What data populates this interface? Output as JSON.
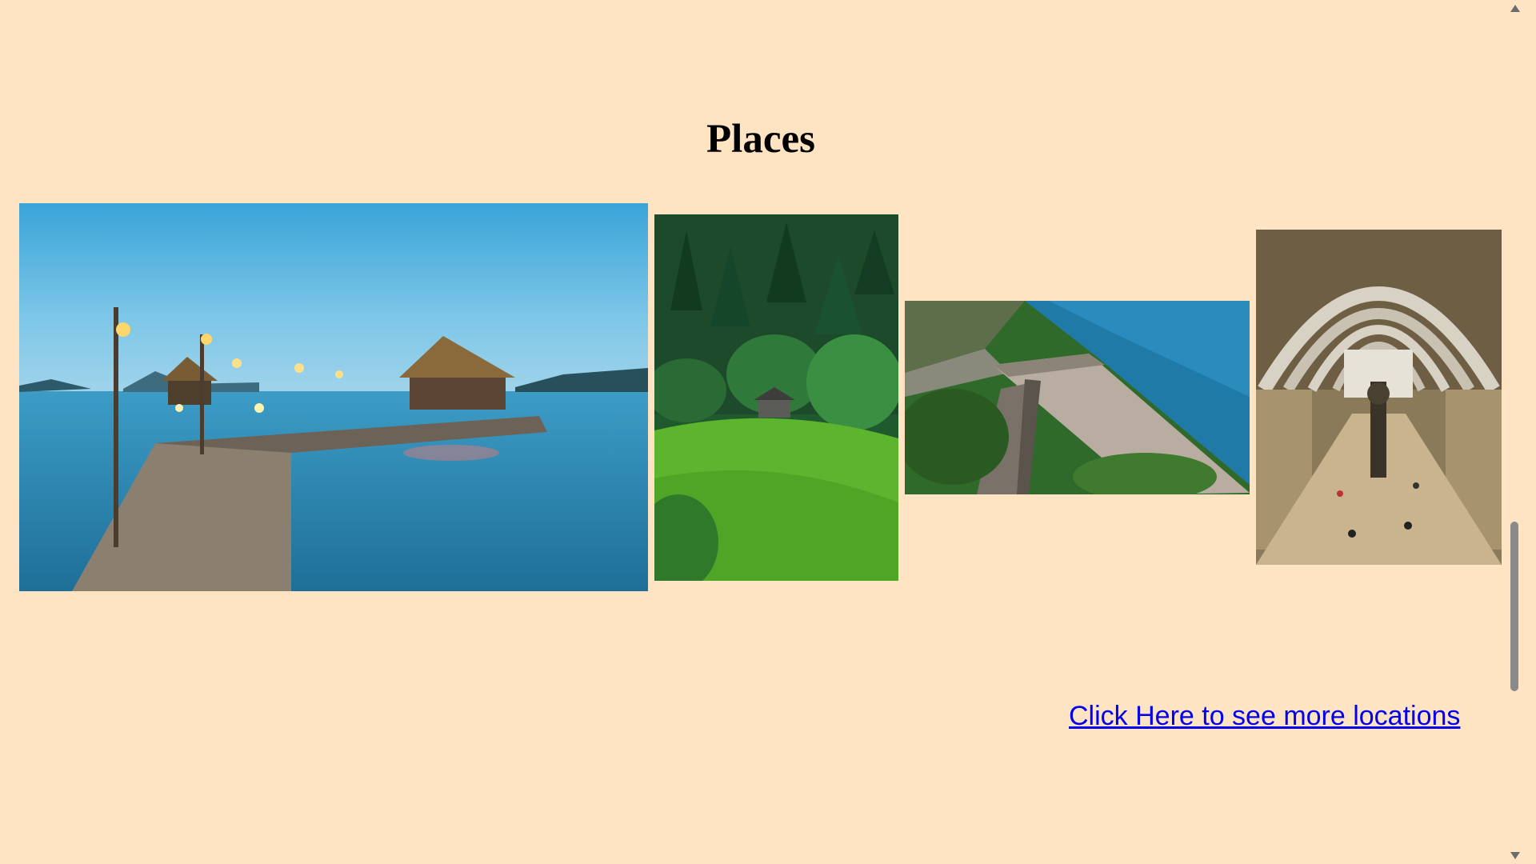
{
  "section": {
    "title": "Places"
  },
  "gallery": {
    "images": [
      {
        "icon": "pier-image"
      },
      {
        "icon": "forest-cabin-image"
      },
      {
        "icon": "dam-image"
      },
      {
        "icon": "museum-hall-image"
      }
    ]
  },
  "link": {
    "label": "Click Here to see more locations"
  },
  "colors": {
    "background": "#ffe4c4",
    "link": "#0000ee"
  }
}
